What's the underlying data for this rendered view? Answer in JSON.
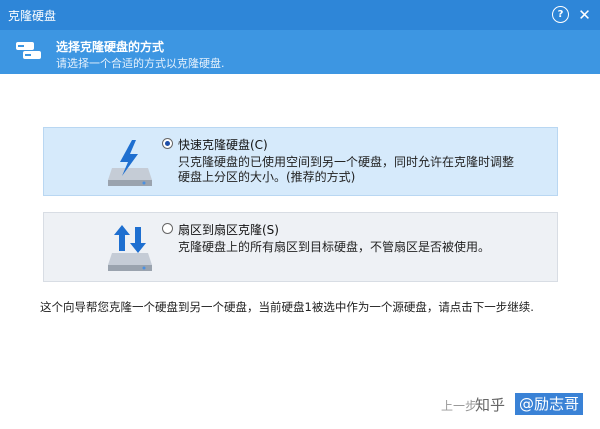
{
  "window": {
    "title": "克隆硬盘",
    "help_glyph": "?",
    "close_glyph": "✕"
  },
  "header": {
    "title": "选择克隆硬盘的方式",
    "subtitle": "请选择一个合适的方式以克隆硬盘."
  },
  "options": [
    {
      "label": "快速克隆硬盘(C)",
      "description": "只克隆硬盘的已使用空间到另一个硬盘，同时允许在克隆时调整硬盘上分区的大小。(推荐的方式)",
      "selected": true,
      "icon": "lightning-disk-icon"
    },
    {
      "label": "扇区到扇区克隆(S)",
      "description": "克隆硬盘上的所有扇区到目标硬盘，不管扇区是否被使用。",
      "selected": false,
      "icon": "sector-arrows-disk-icon"
    }
  ],
  "footer": {
    "info": "这个向导帮您克隆一个硬盘到另一个硬盘，当前硬盘1被选中作为一个源硬盘，请点击下一步继续.",
    "prev_button": "上一步",
    "watermark_site": "知乎",
    "watermark_user": "@励志哥"
  },
  "colors": {
    "titlebar": "#2e86d8",
    "header": "#3d96e2",
    "selected_bg": "#d6eafb"
  }
}
